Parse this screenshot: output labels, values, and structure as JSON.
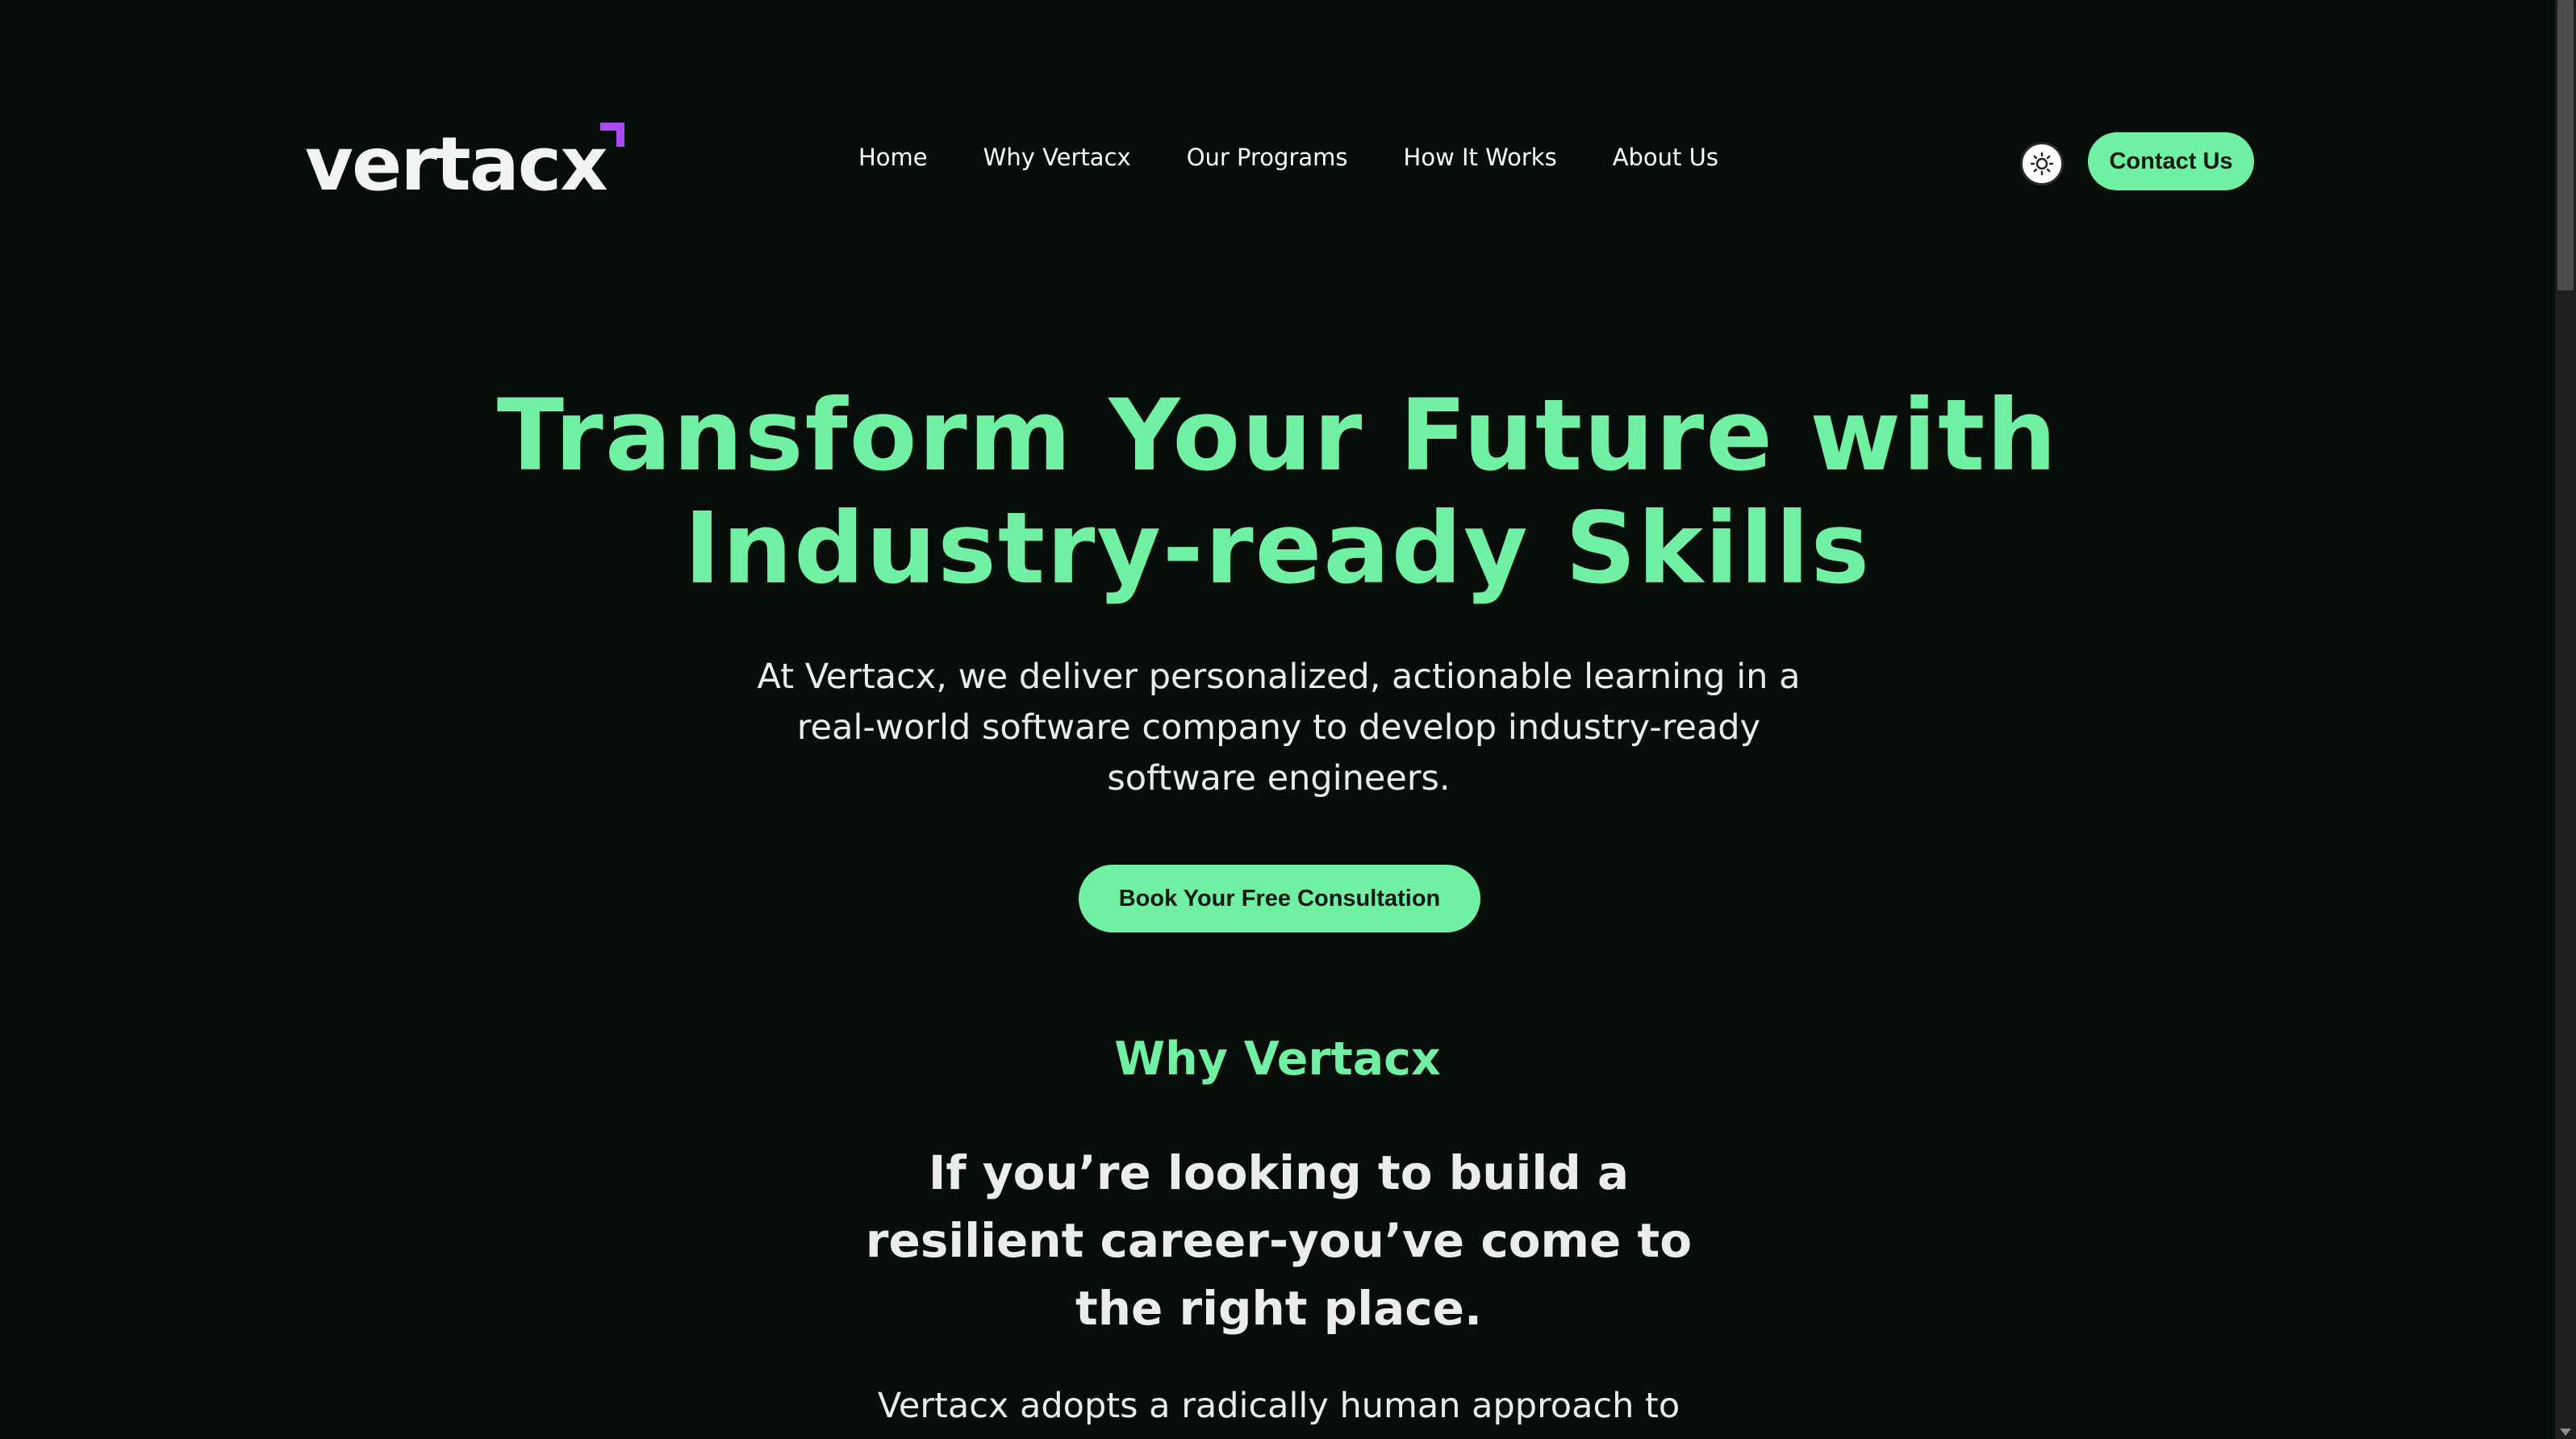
{
  "header": {
    "logo_text": "vertacx",
    "nav": [
      "Home",
      "Why Vertacx",
      "Our Programs",
      "How It Works",
      "About Us"
    ],
    "theme_toggle_icon": "sun-icon",
    "contact_label": "Contact Us"
  },
  "hero": {
    "title_line1": "Transform Your Future with",
    "title_line2": "Industry-ready Skills",
    "subtitle": "At Vertacx, we deliver personalized, actionable learning in a real-world software company to develop industry-ready software engineers.",
    "cta_label": "Book Your Free Consultation"
  },
  "why": {
    "heading": "Why Vertacx",
    "lead": "If you’re looking to build a resilient career-you’ve come to the right place.",
    "body": "Vertacx adopts a radically human approach to"
  },
  "colors": {
    "accent": "#6ff0a3",
    "background": "#070d09",
    "logo_mark": "#a94bf2"
  }
}
